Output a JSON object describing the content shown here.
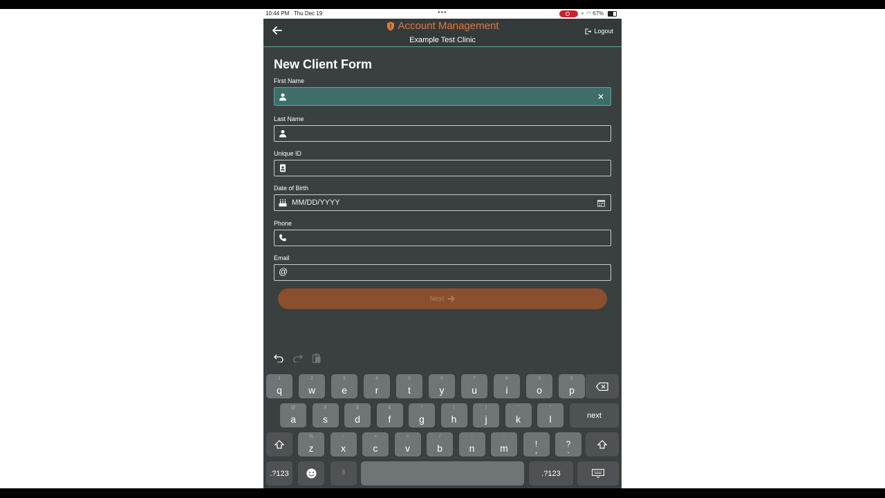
{
  "status_bar": {
    "time": "10:44 PM",
    "date": "Thu Dec 19",
    "battery": "67%"
  },
  "header": {
    "app_title": "Account Management",
    "clinic": "Example Test Clinic",
    "logout": "Logout"
  },
  "form": {
    "title": "New Client Form",
    "fields": [
      {
        "label": "First Name",
        "value": "",
        "placeholder": "",
        "icon": "person-icon"
      },
      {
        "label": "Last Name",
        "value": "",
        "placeholder": "",
        "icon": "person-icon"
      },
      {
        "label": "Unique ID",
        "value": "",
        "placeholder": "",
        "icon": "id-badge-icon"
      },
      {
        "label": "Date of Birth",
        "value": "",
        "placeholder": "MM/DD/YYYY",
        "icon": "cake-icon"
      },
      {
        "label": "Phone",
        "value": "",
        "placeholder": "",
        "icon": "phone-icon"
      },
      {
        "label": "Email",
        "value": "",
        "placeholder": "",
        "icon": "at-icon"
      }
    ],
    "next_button": "Next"
  },
  "colors": {
    "accent": "#e07a3c",
    "teal": "#5aa7a3",
    "background": "#3a3f40",
    "button": "#8a4f2e"
  },
  "keyboard": {
    "row1": [
      {
        "k": "q",
        "s": "1"
      },
      {
        "k": "w",
        "s": "2"
      },
      {
        "k": "e",
        "s": "3"
      },
      {
        "k": "r",
        "s": "4"
      },
      {
        "k": "t",
        "s": "5"
      },
      {
        "k": "y",
        "s": "6"
      },
      {
        "k": "u",
        "s": "7"
      },
      {
        "k": "i",
        "s": "8"
      },
      {
        "k": "o",
        "s": "9"
      },
      {
        "k": "p",
        "s": "0"
      }
    ],
    "row2": [
      {
        "k": "a",
        "s": "@"
      },
      {
        "k": "s",
        "s": "#"
      },
      {
        "k": "d",
        "s": "$"
      },
      {
        "k": "f",
        "s": "&"
      },
      {
        "k": "g",
        "s": "*"
      },
      {
        "k": "h",
        "s": "("
      },
      {
        "k": "j",
        "s": ")"
      },
      {
        "k": "k",
        "s": "'"
      },
      {
        "k": "l",
        "s": "\""
      }
    ],
    "row3": [
      {
        "k": "z",
        "s": "%"
      },
      {
        "k": "x",
        "s": "-"
      },
      {
        "k": "c",
        "s": "+"
      },
      {
        "k": "v",
        "s": "="
      },
      {
        "k": "b",
        "s": "/"
      },
      {
        "k": "n",
        "s": ";"
      },
      {
        "k": "m",
        "s": ":"
      },
      {
        "k": "!\n,",
        "s": ""
      },
      {
        "k": "?\n.",
        "s": ""
      }
    ],
    "next_key": "next",
    "numbers_key": ".?123"
  }
}
